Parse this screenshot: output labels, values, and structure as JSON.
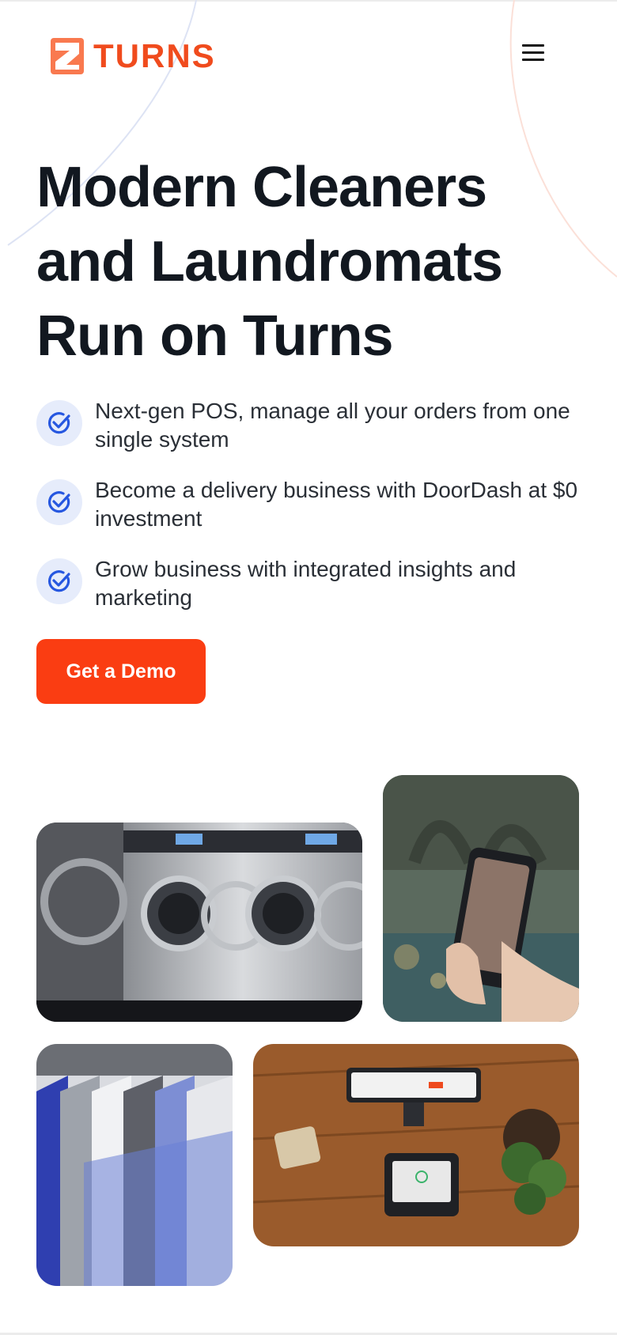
{
  "brand": {
    "name": "TURNS",
    "color": "#f04b1d"
  },
  "header": {
    "menu_icon": "hamburger-menu-icon"
  },
  "hero": {
    "title_lines": [
      "Modern Cleaners",
      "and Laundromats",
      "Run on Turns"
    ],
    "features": [
      {
        "icon": "check-circle-icon",
        "text": "Next-gen POS, manage all your orders from one single system"
      },
      {
        "icon": "check-circle-icon",
        "text": "Become a delivery business with DoorDash at $0 investment"
      },
      {
        "icon": "check-circle-icon",
        "text": "Grow business with integrated insights and marketing"
      }
    ],
    "cta_label": "Get a Demo",
    "cta_color": "#fa3d12"
  },
  "gallery": {
    "images": [
      "laundromat-washing-machines",
      "hand-holding-phone",
      "shirts-on-hangers",
      "pos-terminal-on-table"
    ]
  }
}
